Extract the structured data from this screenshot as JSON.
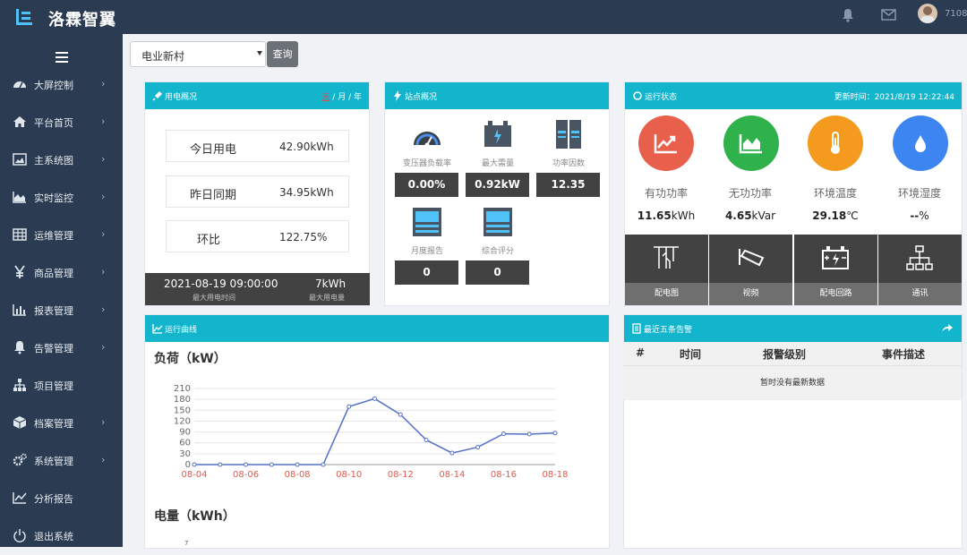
{
  "app": {
    "title": "洛霖智翼",
    "user": "7108"
  },
  "sidebar": {
    "items": [
      {
        "label": "大屏控制",
        "icon": "dashboard-icon",
        "has_children": true
      },
      {
        "label": "平台首页",
        "icon": "home-icon",
        "has_children": true
      },
      {
        "label": "主系统图",
        "icon": "image-icon",
        "has_children": true
      },
      {
        "label": "实时监控",
        "icon": "area-chart-icon",
        "has_children": true
      },
      {
        "label": "运维管理",
        "icon": "table-icon",
        "has_children": true
      },
      {
        "label": "商品管理",
        "icon": "yen-icon",
        "has_children": true
      },
      {
        "label": "报表管理",
        "icon": "bar-chart-icon",
        "has_children": true
      },
      {
        "label": "告警管理",
        "icon": "bell-icon",
        "has_children": true
      },
      {
        "label": "项目管理",
        "icon": "sitemap-icon",
        "has_children": false
      },
      {
        "label": "档案管理",
        "icon": "cube-icon",
        "has_children": true
      },
      {
        "label": "系统管理",
        "icon": "cogs-icon",
        "has_children": true
      },
      {
        "label": "分析报告",
        "icon": "line-chart-icon",
        "has_children": false
      },
      {
        "label": "退出系统",
        "icon": "power-icon",
        "has_children": false
      }
    ]
  },
  "filter": {
    "selected": "电业新村",
    "query_label": "查询"
  },
  "power_usage": {
    "title": "用电概况",
    "period_day": "天",
    "period_sep1": " / ",
    "period_month": "月",
    "period_sep2": " / ",
    "period_year": "年",
    "today_label": "今日用电",
    "today_value": "42.90kWh",
    "yesterday_label": "昨日同期",
    "yesterday_value": "34.95kWh",
    "ratio_label": "环比",
    "ratio_value": "122.75%",
    "max_time": "2021-08-19 09:00:00",
    "max_time_label": "最大用电时间",
    "max_value": "7kWh",
    "max_value_label": "最大用电量"
  },
  "site": {
    "title": "站点概况",
    "items": [
      {
        "label": "变压器负载率",
        "value": "0.00%",
        "icon": "gauge-icon"
      },
      {
        "label": "最大需量",
        "value": "0.92kW",
        "icon": "battery-icon"
      },
      {
        "label": "功率因数",
        "value": "12.35",
        "icon": "server-icon"
      },
      {
        "label": "月度报告",
        "value": "0",
        "icon": "monitor-icon"
      },
      {
        "label": "综合评分",
        "value": "0",
        "icon": "monitor-icon"
      }
    ]
  },
  "status": {
    "title": "运行状态",
    "updated": "更新时间：2021/8/19 12:22:44",
    "metrics": [
      {
        "label": "有功功率",
        "num": "11.65",
        "unit": "kWh",
        "color": "#e8604c"
      },
      {
        "label": "无功功率",
        "num": "4.65",
        "unit": "kVar",
        "color": "#2fb24c"
      },
      {
        "label": "环境温度",
        "num": "29.18",
        "unit": "℃",
        "color": "#f39a1f"
      },
      {
        "label": "环境湿度",
        "num": "--",
        "unit": "%",
        "color": "#3d86f2"
      }
    ],
    "tiles": [
      {
        "label": "配电图",
        "icon": "distribution-icon"
      },
      {
        "label": "视频",
        "icon": "camera-icon"
      },
      {
        "label": "配电回路",
        "icon": "battery-circuit-icon"
      },
      {
        "label": "通讯",
        "icon": "network-icon"
      }
    ]
  },
  "curve": {
    "title": "运行曲线",
    "load_title": "负荷（kW）",
    "energy_title": "电量（kWh）"
  },
  "alarms": {
    "title": "最近五条告警",
    "col_no": "#",
    "col_time": "时间",
    "col_level": "报警级别",
    "col_desc": "事件描述",
    "empty": "暂时没有最新数据"
  },
  "chart_data": {
    "type": "line",
    "x": [
      "08-04",
      "08-05",
      "08-06",
      "08-07",
      "08-08",
      "08-09",
      "08-10",
      "08-11",
      "08-12",
      "08-13",
      "08-14",
      "08-15",
      "08-16",
      "08-17",
      "08-18"
    ],
    "values": [
      0,
      0,
      0,
      0,
      0,
      0,
      160,
      182,
      138,
      68,
      32,
      48,
      85,
      84,
      87
    ],
    "x_ticks": [
      "08-04",
      "08-06",
      "08-08",
      "08-10",
      "08-12",
      "08-14",
      "08-16",
      "08-18"
    ],
    "y_ticks": [
      0,
      30,
      60,
      90,
      120,
      150,
      180,
      210
    ],
    "ylim": [
      0,
      210
    ],
    "color": "#5470c6",
    "energy_first_tick": "7"
  }
}
